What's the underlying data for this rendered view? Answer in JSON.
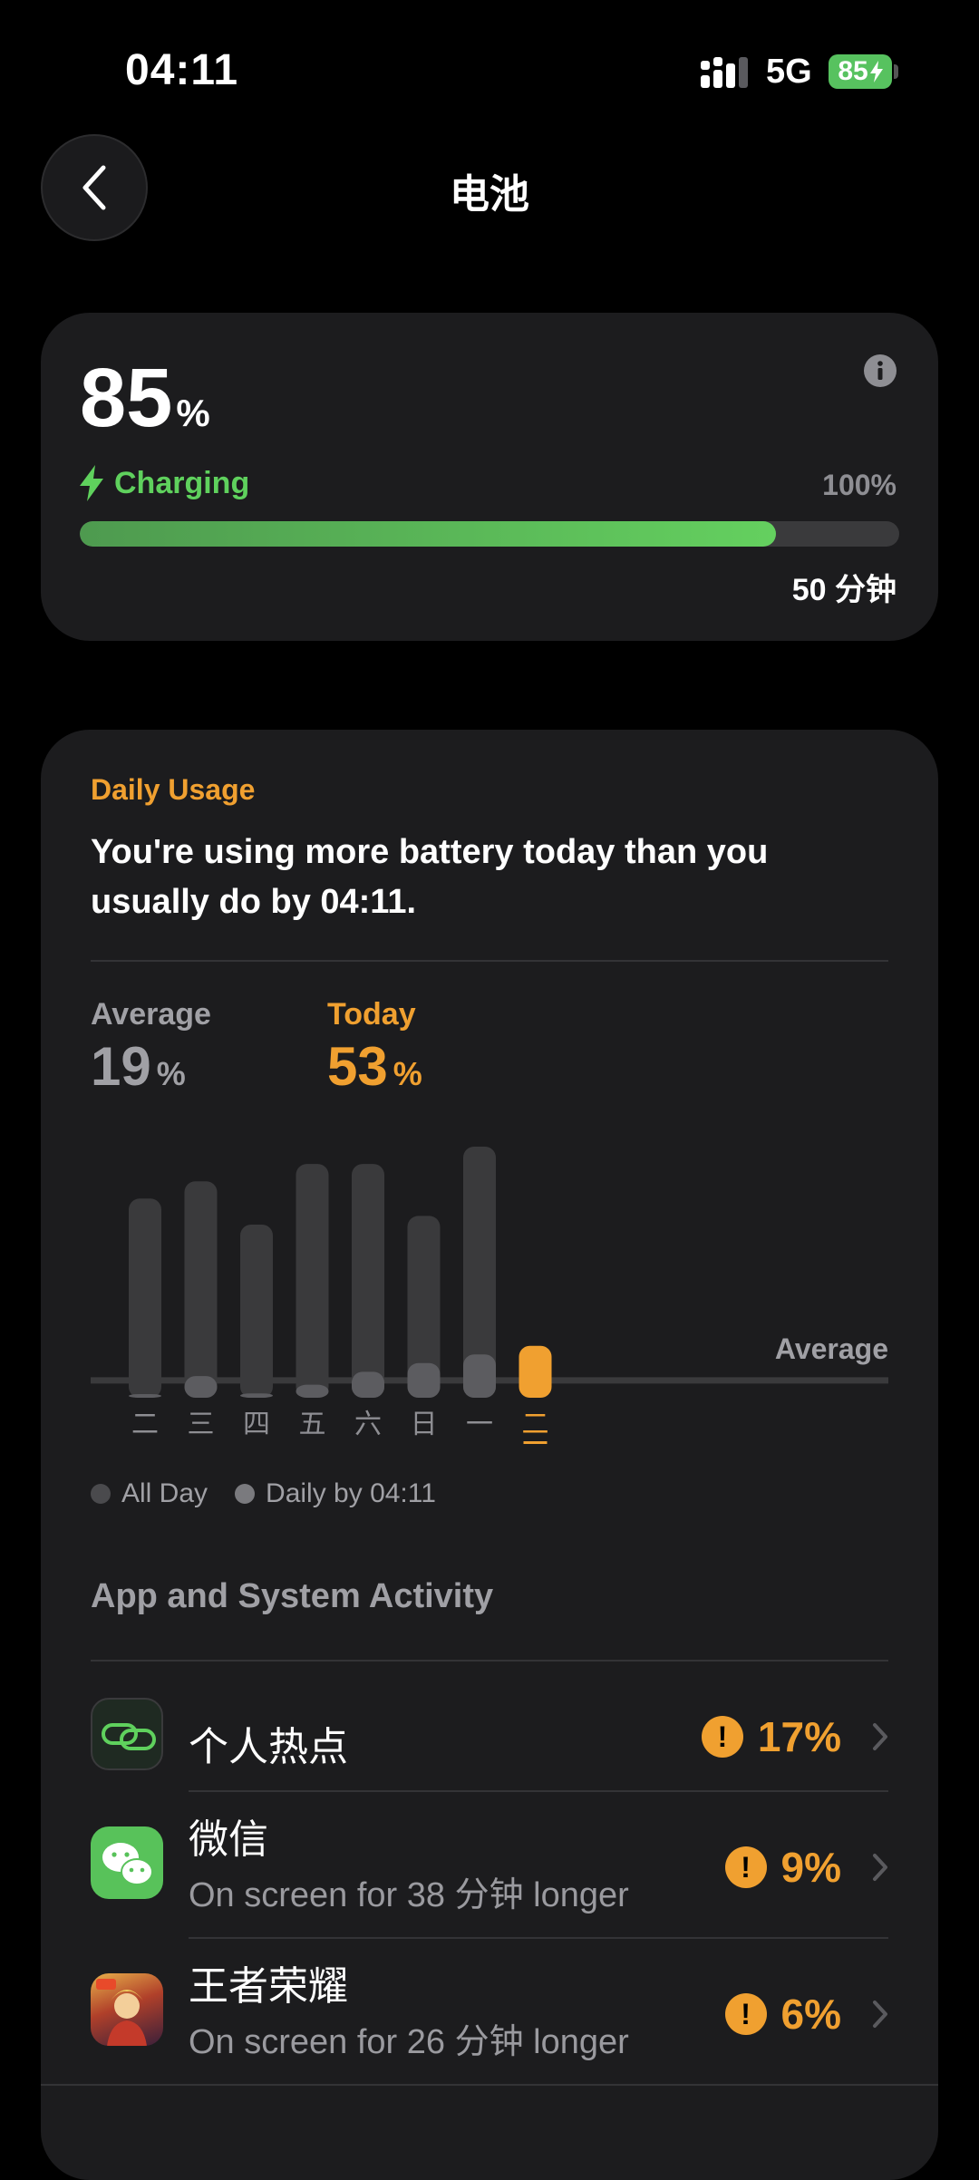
{
  "status_bar": {
    "time": "04:11",
    "network": "5G",
    "battery": "85"
  },
  "header": {
    "title": "电池",
    "back_icon": "chevron-left-icon"
  },
  "battery": {
    "level_value": "85",
    "level_unit": "%",
    "status_label": "Charging",
    "status_icon": "bolt-icon",
    "target_label": "100%",
    "progress": 0.85,
    "time_remaining": "50 分钟",
    "info_icon": "info-icon",
    "accent_color": "#5fd15d"
  },
  "usage": {
    "section_label": "Daily Usage",
    "message": "You're using more battery today than you usually do by 04:11.",
    "average_label": "Average",
    "average_value": "19",
    "average_unit": "%",
    "today_label": "Today",
    "today_value": "53",
    "today_unit": "%",
    "accent_color": "#f0a030"
  },
  "chart_data": {
    "type": "bar",
    "categories": [
      "二",
      "三",
      "四",
      "五",
      "六",
      "日",
      "一",
      "二"
    ],
    "series": [
      {
        "name": "All Day",
        "values": [
          23,
          25,
          20,
          27,
          27,
          21,
          29,
          null
        ]
      },
      {
        "name": "Daily by 04:11",
        "values": [
          0,
          2.5,
          0.5,
          1.5,
          3,
          4,
          5,
          6
        ]
      }
    ],
    "highlight_index": 7,
    "average_label": "Average",
    "average_value": 2,
    "ylim": [
      0,
      29
    ],
    "legend_position": "bottom-left",
    "grid": false
  },
  "legend": {
    "items": [
      {
        "label": "All Day",
        "color": "#4a4a4d"
      },
      {
        "label": "Daily by 04:11",
        "color": "#7a7a7e"
      }
    ]
  },
  "activity": {
    "heading": "App and System Activity",
    "apps": [
      {
        "name": "个人热点",
        "sub": "",
        "pct": "17%",
        "icon": "hotspot-icon"
      },
      {
        "name": "微信",
        "sub": "On screen for 38 分钟 longer",
        "pct": "9%",
        "icon": "wechat-icon"
      },
      {
        "name": "王者荣耀",
        "sub": "On screen for 26 分钟 longer",
        "pct": "6%",
        "icon": "honor-of-kings-icon"
      }
    ]
  }
}
